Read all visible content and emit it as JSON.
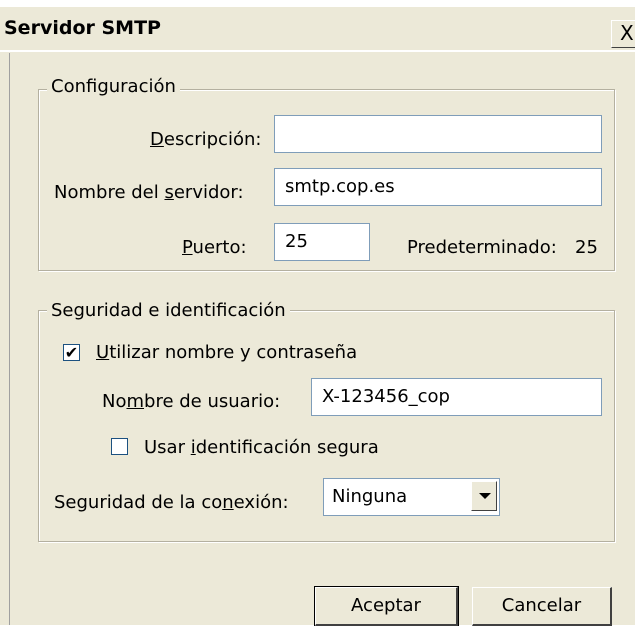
{
  "window": {
    "title": "Servidor SMTP",
    "close_glyph": "X"
  },
  "config": {
    "legend": "Configuración",
    "description": {
      "label_pre": "",
      "label_mn": "D",
      "label_post": "escripción:",
      "value": ""
    },
    "server": {
      "label_pre": "Nombre del ",
      "label_mn": "s",
      "label_post": "ervidor:",
      "value": "smtp.cop.es"
    },
    "port": {
      "label_pre": "",
      "label_mn": "P",
      "label_post": "uerto:",
      "value": "25"
    },
    "default_label": "Predeterminado:",
    "default_value": "25"
  },
  "security": {
    "legend": "Seguridad e identificación",
    "use_auth": {
      "checked": true,
      "check_glyph": "✔",
      "label_pre": "",
      "label_mn": "U",
      "label_post": "tilizar nombre y contraseña"
    },
    "username": {
      "label_pre": "No",
      "label_mn": "m",
      "label_post": "bre de usuario:",
      "value": "X-123456_cop"
    },
    "secure_auth": {
      "checked": false,
      "label_pre": "Usar ",
      "label_mn": "i",
      "label_post": "dentificación segura"
    },
    "connection": {
      "label_pre": "Seguridad de la co",
      "label_mn": "n",
      "label_post": "exión:",
      "value": "Ninguna"
    }
  },
  "buttons": {
    "accept": "Aceptar",
    "cancel": "Cancelar"
  }
}
